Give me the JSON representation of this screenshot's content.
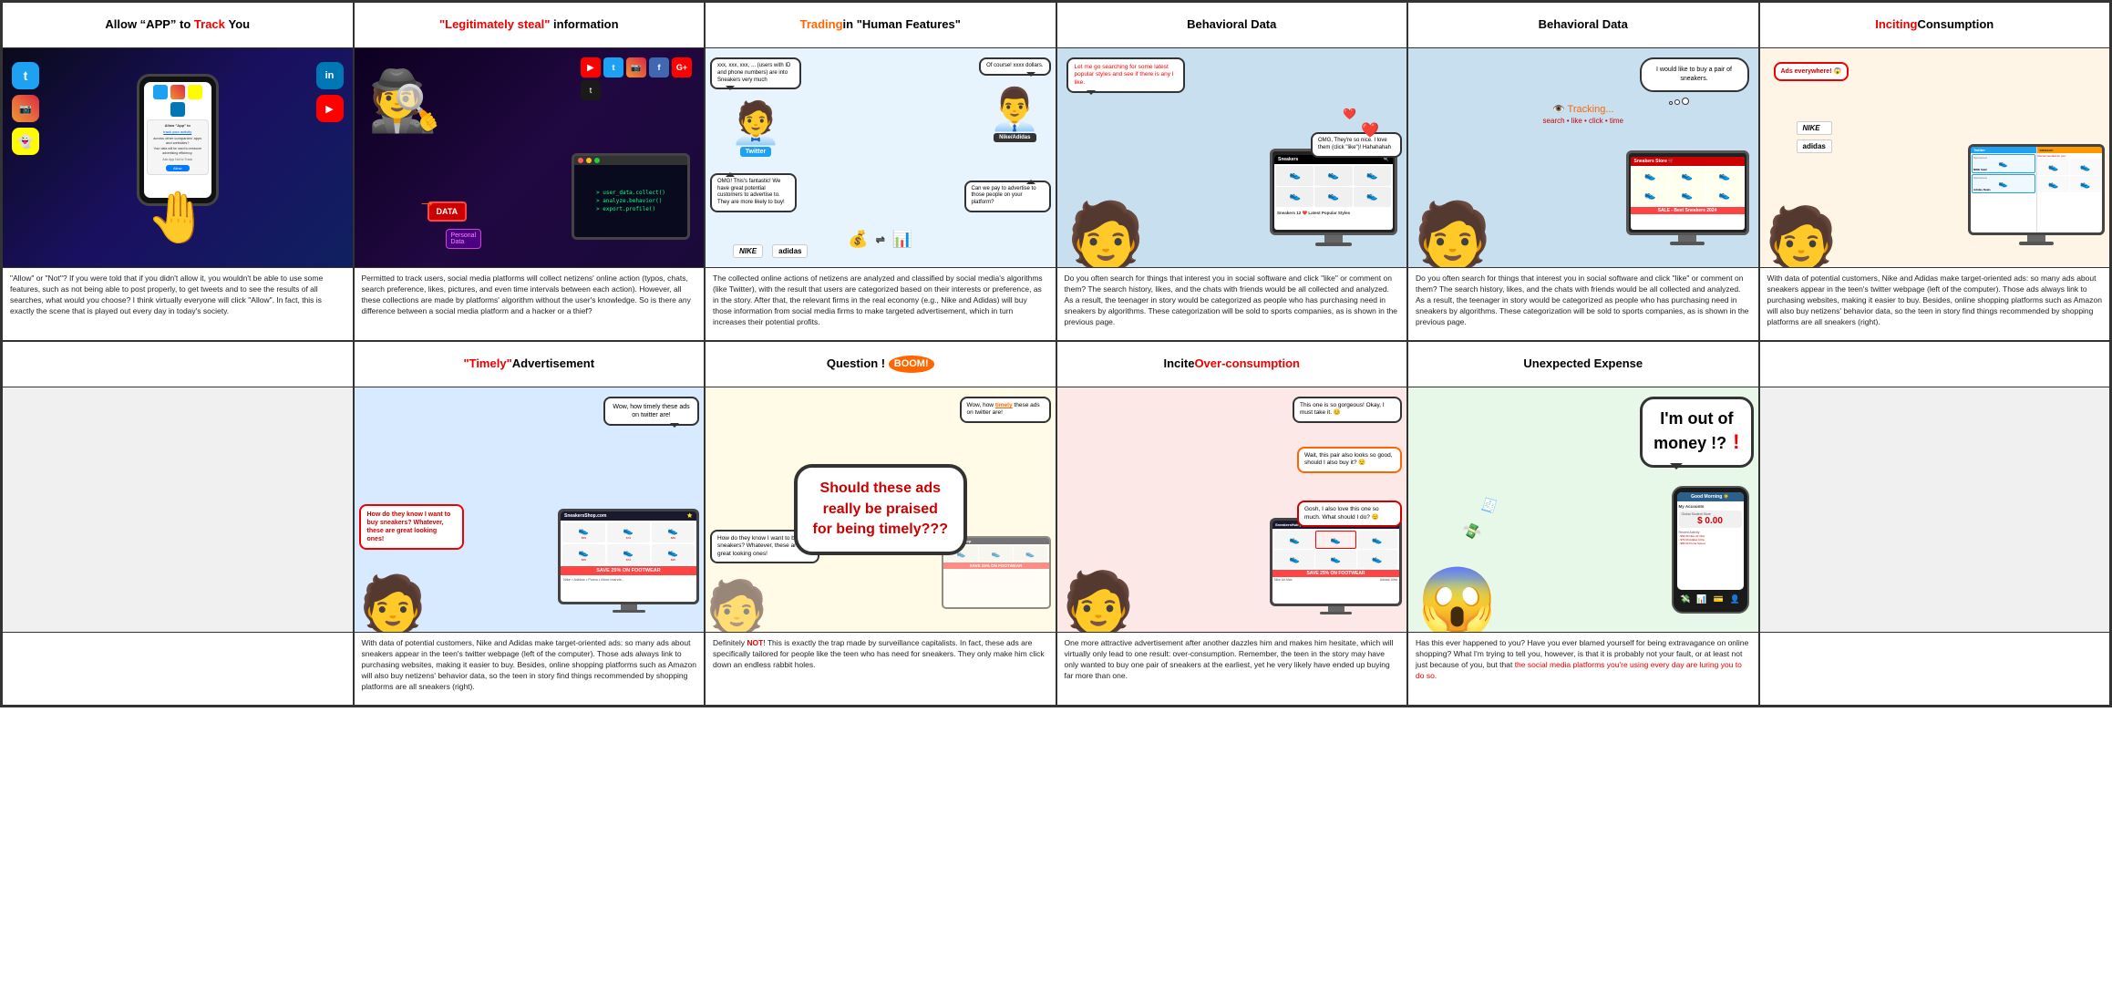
{
  "grid": {
    "rows": [
      {
        "cells": [
          {
            "id": "r1c1",
            "header": {
              "text": "Allow \"APP\" to Track You",
              "parts": [
                {
                  "text": "Allow \"APP\" to ",
                  "style": "normal"
                },
                {
                  "text": "Track",
                  "style": "red"
                },
                {
                  "text": " You",
                  "style": "normal"
                }
              ]
            },
            "body_text": "\"Allow\" or \"Not\"? If you were told that if you didn't allow it, you wouldn't be able to use some features, such as not being able to post properly, to get tweets and to see the results of all searches, what would you choose? I think virtually everyone will click \"Allow\". In fact, this is exactly the scene that is played out every day in today's society.",
            "image_type": "phone_hand"
          },
          {
            "id": "r1c2",
            "header": {
              "text": "\"Legitimately steal\" information",
              "parts": [
                {
                  "text": "\"Legitimately steal\"",
                  "style": "red"
                },
                {
                  "text": " information",
                  "style": "normal"
                }
              ]
            },
            "body_text": "Permitted to track users, social media platforms will collect netizens' online action (typos, chats, search preference, likes, pictures, and even time intervals between each action). However, all these collections are made by platforms' algorithm without the user's knowledge. So is there any difference between a social media platform and a hacker or a thief?",
            "image_type": "burglar"
          },
          {
            "id": "r1c3",
            "header": {
              "text": "Trading in \"Human Features\"",
              "parts": [
                {
                  "text": "Trading",
                  "style": "orange"
                },
                {
                  "text": " in \"Human Features\"",
                  "style": "normal"
                }
              ]
            },
            "body_text": "The collected online actions of netizens are analyzed and classified by social media's algorithms (like Twitter), with the result that users are categorized based on their interests or preference, as in the story. After that, the relevant firms in the real economy (e.g., Nike and Adidas) will buy those information from social media firms to make targeted advertisement, which in turn increases their potential profits.",
            "image_type": "business_deal",
            "speech1": "xxx, xxx, xxx, ... (users with ID and phone numbers) are into Sneakers very much",
            "speech2": "Of course! xxxx dollars.",
            "speech3": "OMG! This's fantastic! We have great potential customers to advertise to. They are more likely to buy!",
            "speech4": "Can we pay to advertise to those people on your platform?"
          },
          {
            "id": "r1c4",
            "header": {
              "text": "Behavioral Data",
              "parts": [
                {
                  "text": "Behavioral Data",
                  "style": "normal"
                }
              ]
            },
            "body_text": "Do you often search for things that interest you in social software and click \"like\" or comment on them? The search history, likes, and the chats with friends would be all collected and analyzed. As a result, the teenager in story would be categorized as people who has purchasing need in sneakers by algorithms. These categorization will be sold to sports companies, as is shown in the previous page.",
            "image_type": "teen_computer1",
            "speech1": "Let me go searching for some latest popular styles and see if there is any I like.",
            "speech2": "OMG, They're so nice. I love them (click \"like\")! Hahahahah"
          },
          {
            "id": "r1c5",
            "header": {
              "text": "Behavioral Data",
              "parts": [
                {
                  "text": "Behavioral Data",
                  "style": "normal"
                }
              ]
            },
            "body_text": "Do you often search for things that interest you in social software and click \"like\" or comment on them? The search history, likes, and the chats with friends would be all collected and analyzed. As a result, the teenager in story would be categorized as people who has purchasing need in sneakers by algorithms. These categorization will be sold to sports companies, as is shown in the previous page.",
            "image_type": "teen_computer2"
          },
          {
            "id": "r1c6",
            "header": {
              "text": "Inciting Consumption",
              "parts": [
                {
                  "text": "Inciting",
                  "style": "red"
                },
                {
                  "text": " Consumption",
                  "style": "normal"
                }
              ]
            },
            "body_text": "With data of potential customers, Nike and Adidas make target-oriented ads: so many ads about sneakers appear in the teen's twitter webpage (left of the computer). Those ads always link to purchasing websites, making it easier to buy. Besides, online shopping platforms such as Amazon will also buy netizens' behavior data, so the teen in story find things recommended by shopping platforms are all sneakers (right).",
            "image_type": "inciting_consumption"
          }
        ]
      },
      {
        "cells": [
          {
            "id": "r2c1",
            "header": {
              "text": "",
              "parts": []
            },
            "body_text": "",
            "image_type": "empty"
          },
          {
            "id": "r2c2",
            "header": {
              "text": "\"Timely\" Advertisement",
              "parts": [
                {
                  "text": "\"Timely\"",
                  "style": "red"
                },
                {
                  "text": " Advertisement",
                  "style": "normal"
                }
              ]
            },
            "body_text": "With data of potential customers, Nike and Adidas make target-oriented ads: so many ads about sneakers appear in the teen's twitter webpage (left of the computer). Those ads always link to purchasing websites, making it easier to buy. Besides, online shopping platforms such as Amazon will also buy netizens' behavior data, so the teen in story find things recommended by shopping platforms are all sneakers (right).",
            "image_type": "timely_ad",
            "speech1": "Wow, how timely these ads on twitter are!",
            "speech2": "How do they know I want to buy sneakers? Whatever, these are great looking ones!"
          },
          {
            "id": "r2c3",
            "header": {
              "text": "Question !",
              "boom": "BOOM!",
              "parts": [
                {
                  "text": "Question !",
                  "style": "normal"
                },
                {
                  "text": "BOOM!",
                  "style": "boom"
                }
              ]
            },
            "body_text": "Definitely NOT! This is exactly the trap made by surveillance capitalists. In fact, these ads are specifically tailored for people like the teen who has need for sneakers. They only make him click down an endless rabbit holes.",
            "image_type": "question",
            "big_question": "Should these ads really be praised for being timely???",
            "speech1": "Wow, how timely these ads on twitter are!"
          },
          {
            "id": "r2c4",
            "header": {
              "text": "Incite Over-consumption",
              "parts": [
                {
                  "text": "Incite ",
                  "style": "normal"
                },
                {
                  "text": "Over-consumption",
                  "style": "red"
                }
              ]
            },
            "body_text": "One more attractive advertisement after another dazzles him and makes him hesitate, which will virtually only lead to one result: over-consumption. Remember, the teen in the story may have only wanted to buy one pair of sneakers at the earliest, yet he very likely have ended up buying far more than one.",
            "image_type": "overconsume",
            "speech1": "This one is so gorgeous! Okay, I must take it.",
            "speech2": "Wait, this pair also looks so good, should I also buy it?",
            "speech3": "Gosh, I also love this one so much. What should I do?"
          },
          {
            "id": "r2c5",
            "header": {
              "text": "Unexpected Expense",
              "parts": [
                {
                  "text": "Unexpected Expense",
                  "style": "normal"
                }
              ]
            },
            "body_text": "Has this ever happened to you? Have you ever blamed yourself for being extravagance on online shopping? What I'm trying to tell you, however, is that it is probably not your fault, or at least not just because of you, but that the social media platforms you're using every day are luring you to do so.",
            "image_type": "unexpected_expense",
            "speech_main": "I'm out of money !?",
            "body_text_red": "the social media platforms you're using every day are luring you to do so."
          },
          {
            "id": "r2c6",
            "header": {
              "text": "",
              "parts": []
            },
            "body_text": "",
            "image_type": "empty"
          }
        ]
      }
    ]
  }
}
